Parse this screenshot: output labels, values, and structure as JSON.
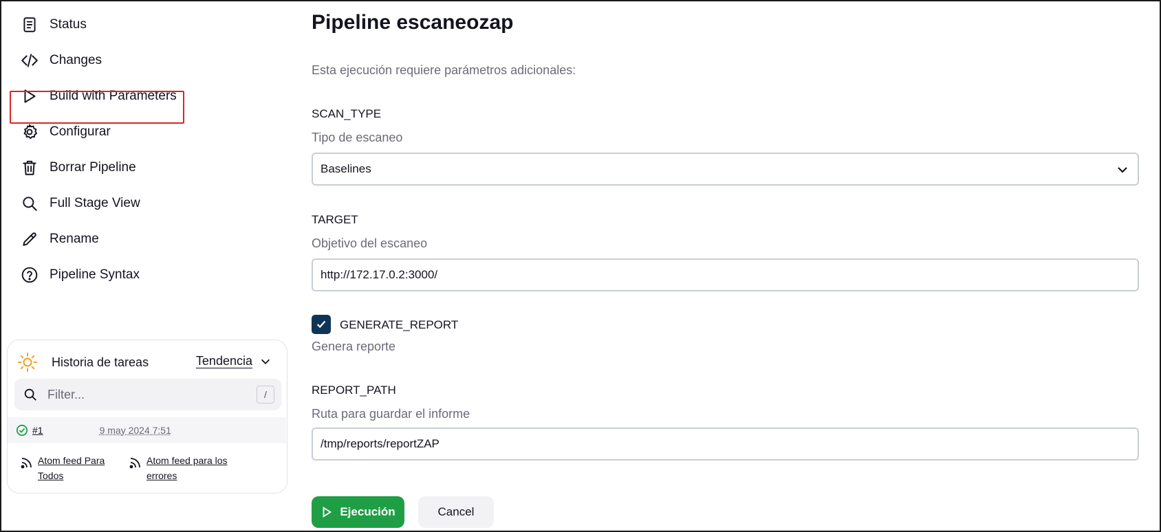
{
  "sidebar": {
    "items": [
      {
        "label": "Status",
        "icon": "document-icon"
      },
      {
        "label": "Changes",
        "icon": "code-icon"
      },
      {
        "label": "Build with Parameters",
        "icon": "play-icon"
      },
      {
        "label": "Configurar",
        "icon": "gear-icon"
      },
      {
        "label": "Borrar Pipeline",
        "icon": "trash-icon"
      },
      {
        "label": "Full Stage View",
        "icon": "search-icon"
      },
      {
        "label": "Rename",
        "icon": "pencil-icon"
      },
      {
        "label": "Pipeline Syntax",
        "icon": "help-icon"
      }
    ],
    "highlight_color": "#d7262b"
  },
  "history": {
    "title": "Historia de tareas",
    "trend_label": "Tendencia",
    "filter_placeholder": "Filter...",
    "filter_shortcut": "/",
    "builds": [
      {
        "number": "#1",
        "date": "9 may 2024 7:51",
        "status": "success"
      }
    ],
    "feeds": [
      {
        "label": "Atom feed Para Todos"
      },
      {
        "label": "Atom feed para los errores"
      }
    ]
  },
  "main": {
    "title": "Pipeline escaneozap",
    "intro": "Esta ejecución requiere parámetros adicionales:",
    "params": [
      {
        "name": "SCAN_TYPE",
        "description": "Tipo de escaneo",
        "type": "choice",
        "value": "Baselines"
      },
      {
        "name": "TARGET",
        "description": "Objetivo del escaneo",
        "type": "string",
        "value": "http://172.17.0.2:3000/"
      },
      {
        "name": "GENERATE_REPORT",
        "description": "Genera reporte",
        "type": "boolean",
        "checked": true
      },
      {
        "name": "REPORT_PATH",
        "description": "Ruta para guardar el informe",
        "type": "string",
        "value": "/tmp/reports/reportZAP"
      }
    ],
    "run_button": "Ejecución",
    "cancel_button": "Cancel",
    "colors": {
      "run": "#1f9e45",
      "checkbox": "#0f3556"
    }
  }
}
